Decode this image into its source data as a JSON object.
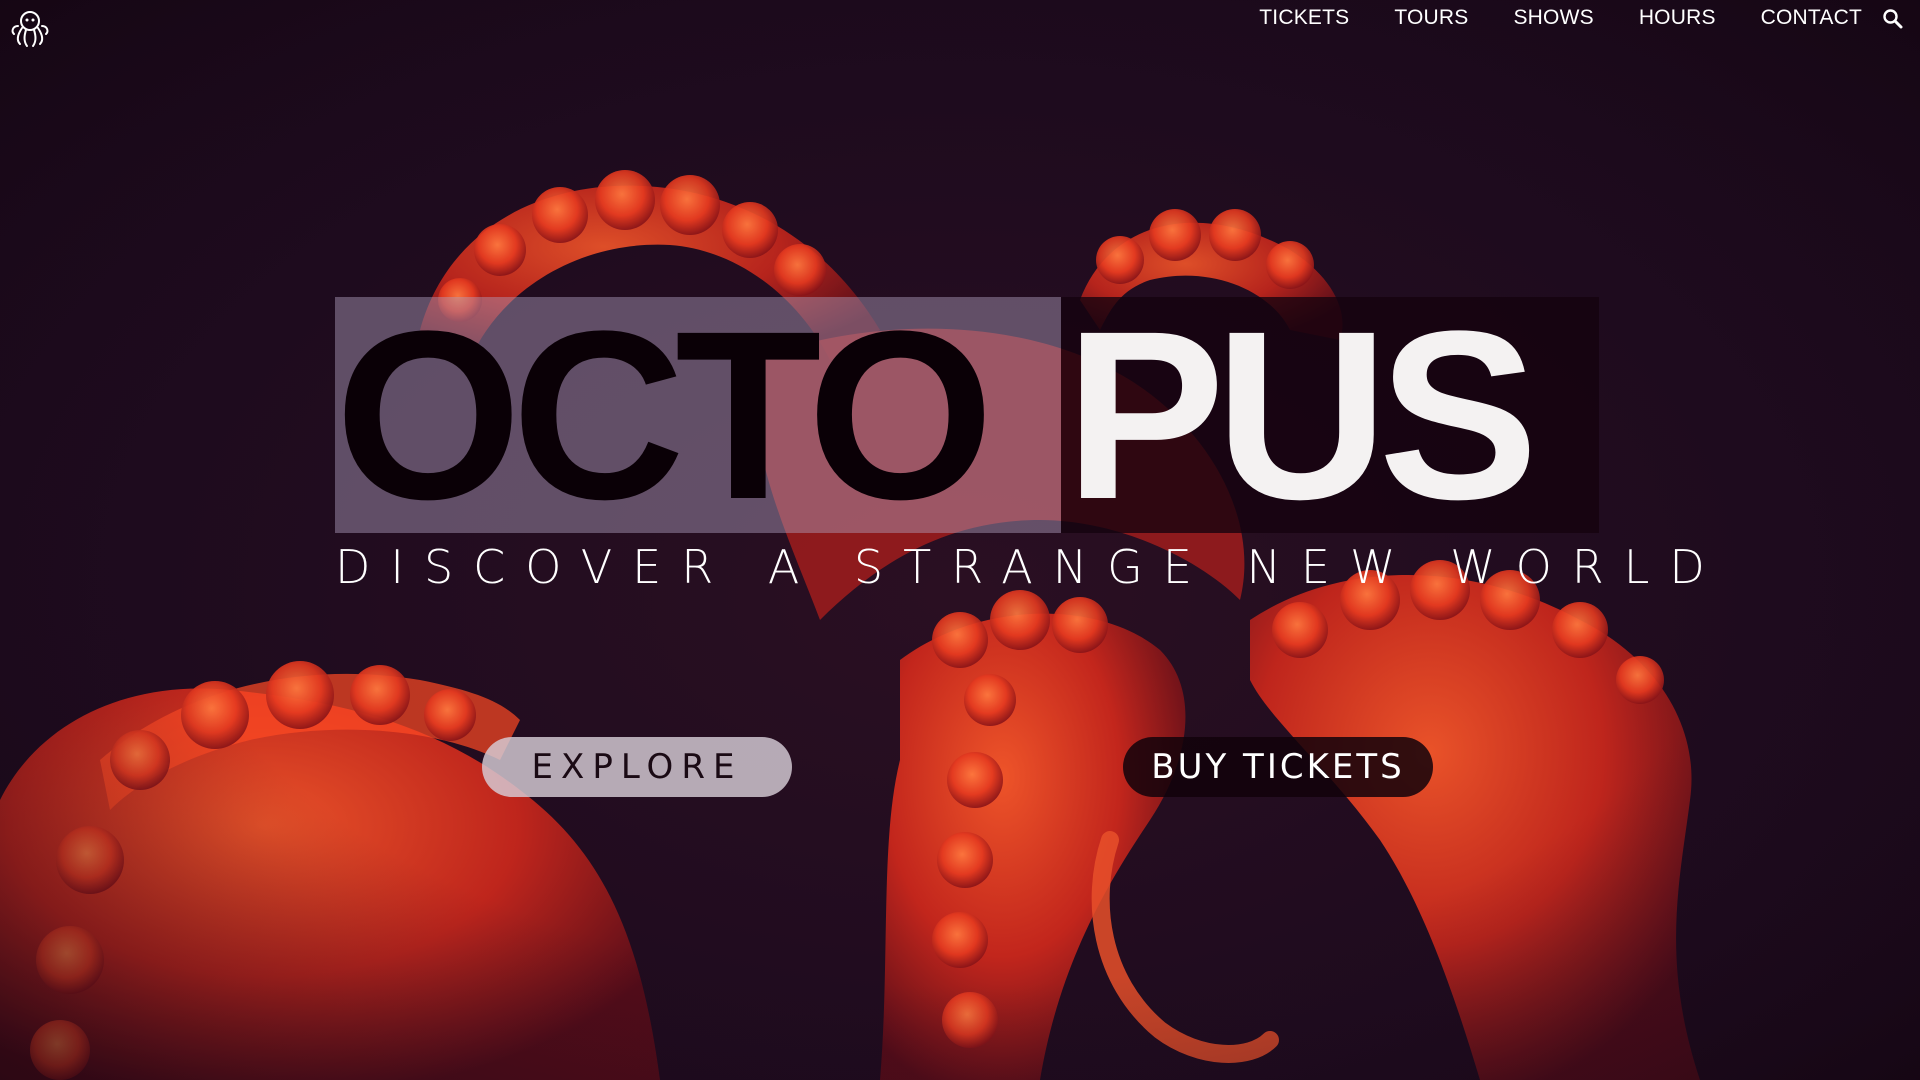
{
  "header": {
    "logo_icon": "octopus-logo-icon",
    "nav": [
      {
        "label": "TICKETS"
      },
      {
        "label": "TOURS"
      },
      {
        "label": "SHOWS"
      },
      {
        "label": "HOURS"
      },
      {
        "label": "CONTACT"
      }
    ],
    "search_icon": "search-icon"
  },
  "hero": {
    "title_part1": "OCTO",
    "title_part2": "PUS",
    "tagline": "DISCOVER A STRANGE NEW WORLD",
    "buttons": {
      "explore": "EXPLORE",
      "buy_tickets": "BUY TICKETS"
    }
  },
  "colors": {
    "background": "#1e0c1f",
    "tentacle": "#e8321c",
    "title_light_box": "#afa0be",
    "title_dark_box": "#14030e",
    "title_dark_text": "#0a0006",
    "title_light_text": "#f4f2f2"
  }
}
